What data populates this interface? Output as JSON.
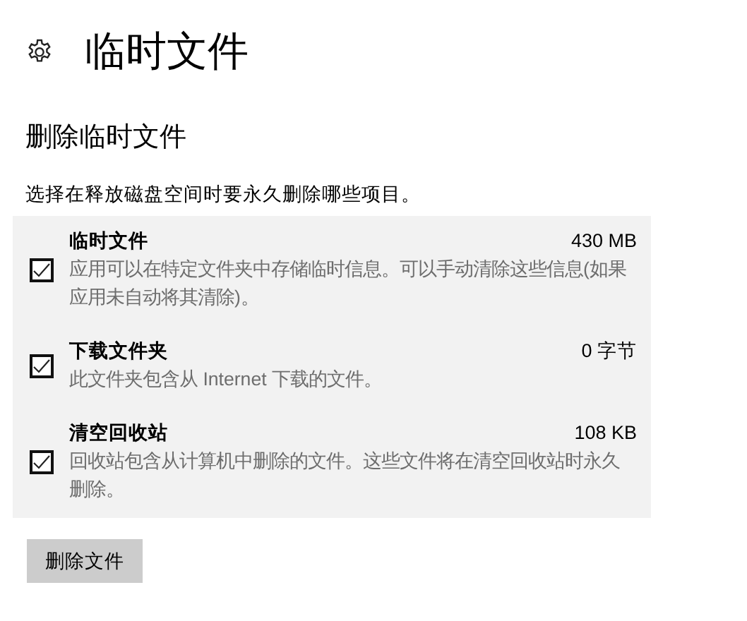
{
  "page": {
    "title": "临时文件"
  },
  "section": {
    "heading": "删除临时文件",
    "description": "选择在释放磁盘空间时要永久删除哪些项目。"
  },
  "items": [
    {
      "name": "临时文件",
      "size": "430 MB",
      "description": "应用可以在特定文件夹中存储临时信息。可以手动清除这些信息(如果应用未自动将其清除)。",
      "checked": true
    },
    {
      "name": "下载文件夹",
      "size": "0 字节",
      "description": "此文件夹包含从 Internet 下载的文件。",
      "checked": true
    },
    {
      "name": "清空回收站",
      "size": "108 KB",
      "description": "回收站包含从计算机中删除的文件。这些文件将在清空回收站时永久删除。",
      "checked": true
    }
  ],
  "button": "删除文件"
}
